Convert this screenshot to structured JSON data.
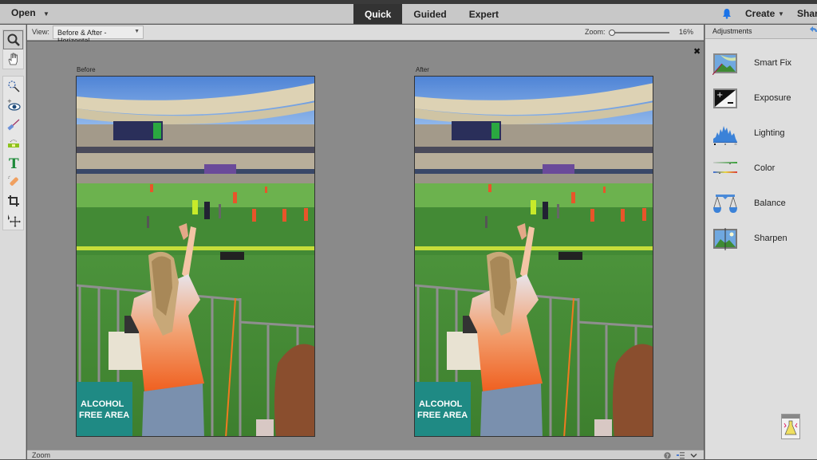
{
  "menubar": {
    "open_label": "Open",
    "modes": [
      {
        "label": "Quick",
        "active": true
      },
      {
        "label": "Guided",
        "active": false
      },
      {
        "label": "Expert",
        "active": false
      }
    ],
    "create_label": "Create",
    "share_label": "Share",
    "notification_color": "#1a73e8"
  },
  "toolbar": {
    "tools": [
      {
        "name": "zoom-tool",
        "icon": "magnifier-icon",
        "selected": true
      },
      {
        "name": "hand-tool",
        "icon": "hand-icon",
        "selected": false
      },
      {
        "name": "quick-selection-tool",
        "icon": "quick-selection-icon",
        "selected": false
      },
      {
        "name": "red-eye-tool",
        "icon": "eye-icon",
        "selected": false
      },
      {
        "name": "whiten-teeth-tool",
        "icon": "brush-icon",
        "selected": false
      },
      {
        "name": "straighten-tool",
        "icon": "level-icon",
        "selected": false
      },
      {
        "name": "type-tool",
        "icon": "type-icon",
        "selected": false
      },
      {
        "name": "spot-healing-tool",
        "icon": "bandage-icon",
        "selected": false
      },
      {
        "name": "crop-tool",
        "icon": "crop-icon",
        "selected": false
      },
      {
        "name": "move-tool",
        "icon": "move-icon",
        "selected": false
      }
    ]
  },
  "options": {
    "view_label": "View:",
    "view_value": "Before & After - Horizontal",
    "zoom_label": "Zoom:",
    "zoom_value": "16%",
    "zoom_fraction": 0.0
  },
  "canvas": {
    "before_label": "Before",
    "after_label": "After",
    "sign_text_line1": "ALCOHOL",
    "sign_text_line2": "FREE AREA"
  },
  "statusbar": {
    "label": "Zoom"
  },
  "adjustments": {
    "title": "Adjustments",
    "items": [
      {
        "label": "Smart Fix",
        "icon": "smart-fix-icon"
      },
      {
        "label": "Exposure",
        "icon": "exposure-icon"
      },
      {
        "label": "Lighting",
        "icon": "lighting-icon"
      },
      {
        "label": "Color",
        "icon": "color-icon"
      },
      {
        "label": "Balance",
        "icon": "balance-icon"
      },
      {
        "label": "Sharpen",
        "icon": "sharpen-icon"
      }
    ]
  }
}
